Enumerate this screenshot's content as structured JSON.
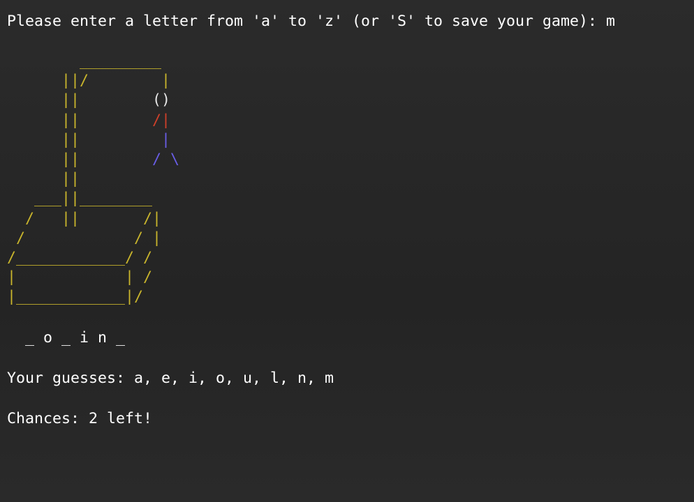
{
  "prompt": {
    "text": "Please enter a letter from 'a' to 'z' (or 'S' to save your game): ",
    "input": "m"
  },
  "word": {
    "masked": "_ o _ i n _"
  },
  "guesses": {
    "label": "Your guesses: ",
    "list": "a, e, i, o, u, l, n, m"
  },
  "chances": {
    "text": "Chances: 2 left!",
    "remaining": 2
  },
  "colors": {
    "gallows": "#c9b52c",
    "head": "#e6e6e6",
    "left_arm": "#d0402a",
    "body": "#6a5ee8",
    "legs": "#6a5ee8",
    "background": "#262626",
    "text": "#ffffff"
  }
}
